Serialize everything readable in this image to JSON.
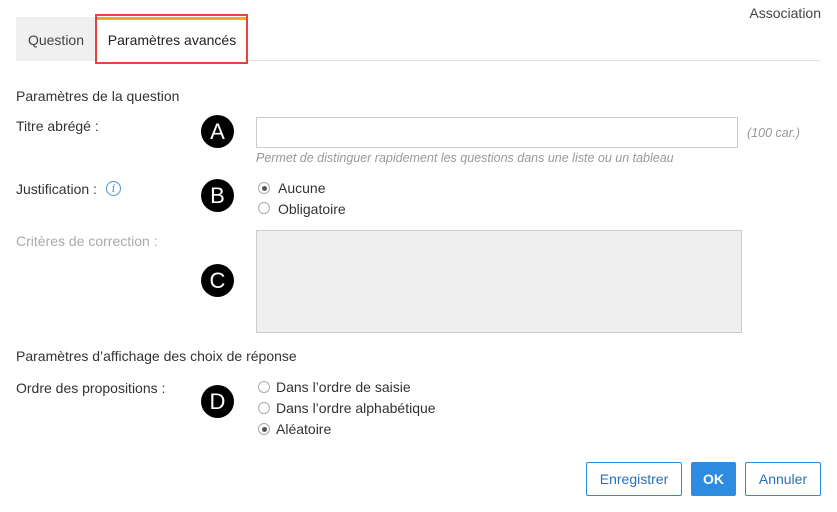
{
  "header": {
    "mode_label": "Association"
  },
  "tabs": [
    {
      "label": "Question"
    },
    {
      "label": "Paramètres avancés"
    }
  ],
  "section_question": {
    "title": "Paramètres de la question"
  },
  "titre": {
    "label": "Titre abrégé :",
    "marker": "A",
    "value": "",
    "limit": "(100 car.)",
    "hint": "Permet de distinguer rapidement les questions dans une liste ou un tableau"
  },
  "justification": {
    "label": "Justification :",
    "info_icon": "info-icon",
    "marker": "B",
    "options": [
      {
        "label": "Aucune",
        "selected": true
      },
      {
        "label": "Obligatoire",
        "selected": false
      }
    ]
  },
  "criteres": {
    "label": "Critères de correction :",
    "marker": "C"
  },
  "section_affichage": {
    "title": "Paramètres d’affichage des choix de réponse"
  },
  "ordre": {
    "label": "Ordre des propositions :",
    "marker": "D",
    "options": [
      {
        "label": "Dans l’ordre de saisie",
        "selected": false
      },
      {
        "label": "Dans l’ordre alphabétique",
        "selected": false
      },
      {
        "label": "Aléatoire",
        "selected": true
      }
    ]
  },
  "buttons": {
    "save": "Enregistrer",
    "ok": "OK",
    "cancel": "Annuler"
  },
  "colors": {
    "accent": "#2d8be0",
    "tab_active_top": "#f5a623",
    "highlight": "#e8423f"
  }
}
